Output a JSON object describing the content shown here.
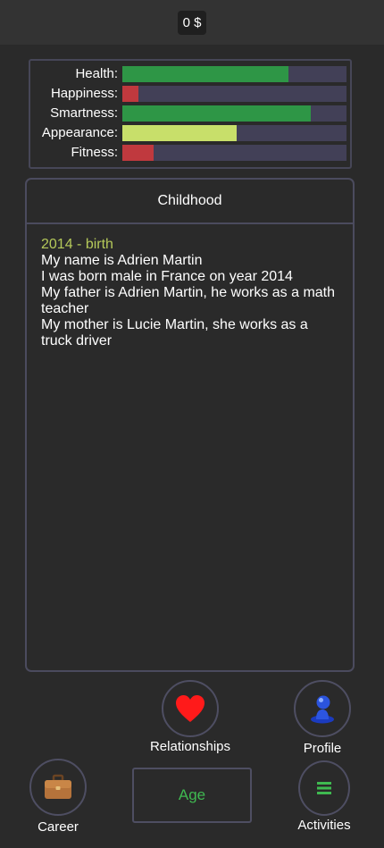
{
  "topbar": {
    "money": "0 $"
  },
  "stats": [
    {
      "label": "Health:",
      "value": 0.74,
      "color": "#2e9646"
    },
    {
      "label": "Happiness:",
      "value": 0.07,
      "color": "#c0393e"
    },
    {
      "label": "Smartness:",
      "value": 0.84,
      "color": "#2e9646"
    },
    {
      "label": "Appearance:",
      "value": 0.51,
      "color": "#c8df6a"
    },
    {
      "label": "Fitness:",
      "value": 0.14,
      "color": "#c0393e"
    }
  ],
  "panel": {
    "title": "Childhood",
    "year_line": "2014 - birth",
    "lines": [
      "My name is Adrien Martin",
      "I was born male in France on year 2014",
      "My father is Adrien Martin, he works as a math teacher",
      "My mother is Lucie Martin, she works as a truck driver"
    ]
  },
  "nav": {
    "relationships": "Relationships",
    "profile": "Profile",
    "career": "Career",
    "age": "Age",
    "activities": "Activities"
  },
  "icons": {
    "relationships": "heart-icon",
    "profile": "person-icon",
    "career": "briefcase-icon",
    "activities": "menu-icon"
  }
}
